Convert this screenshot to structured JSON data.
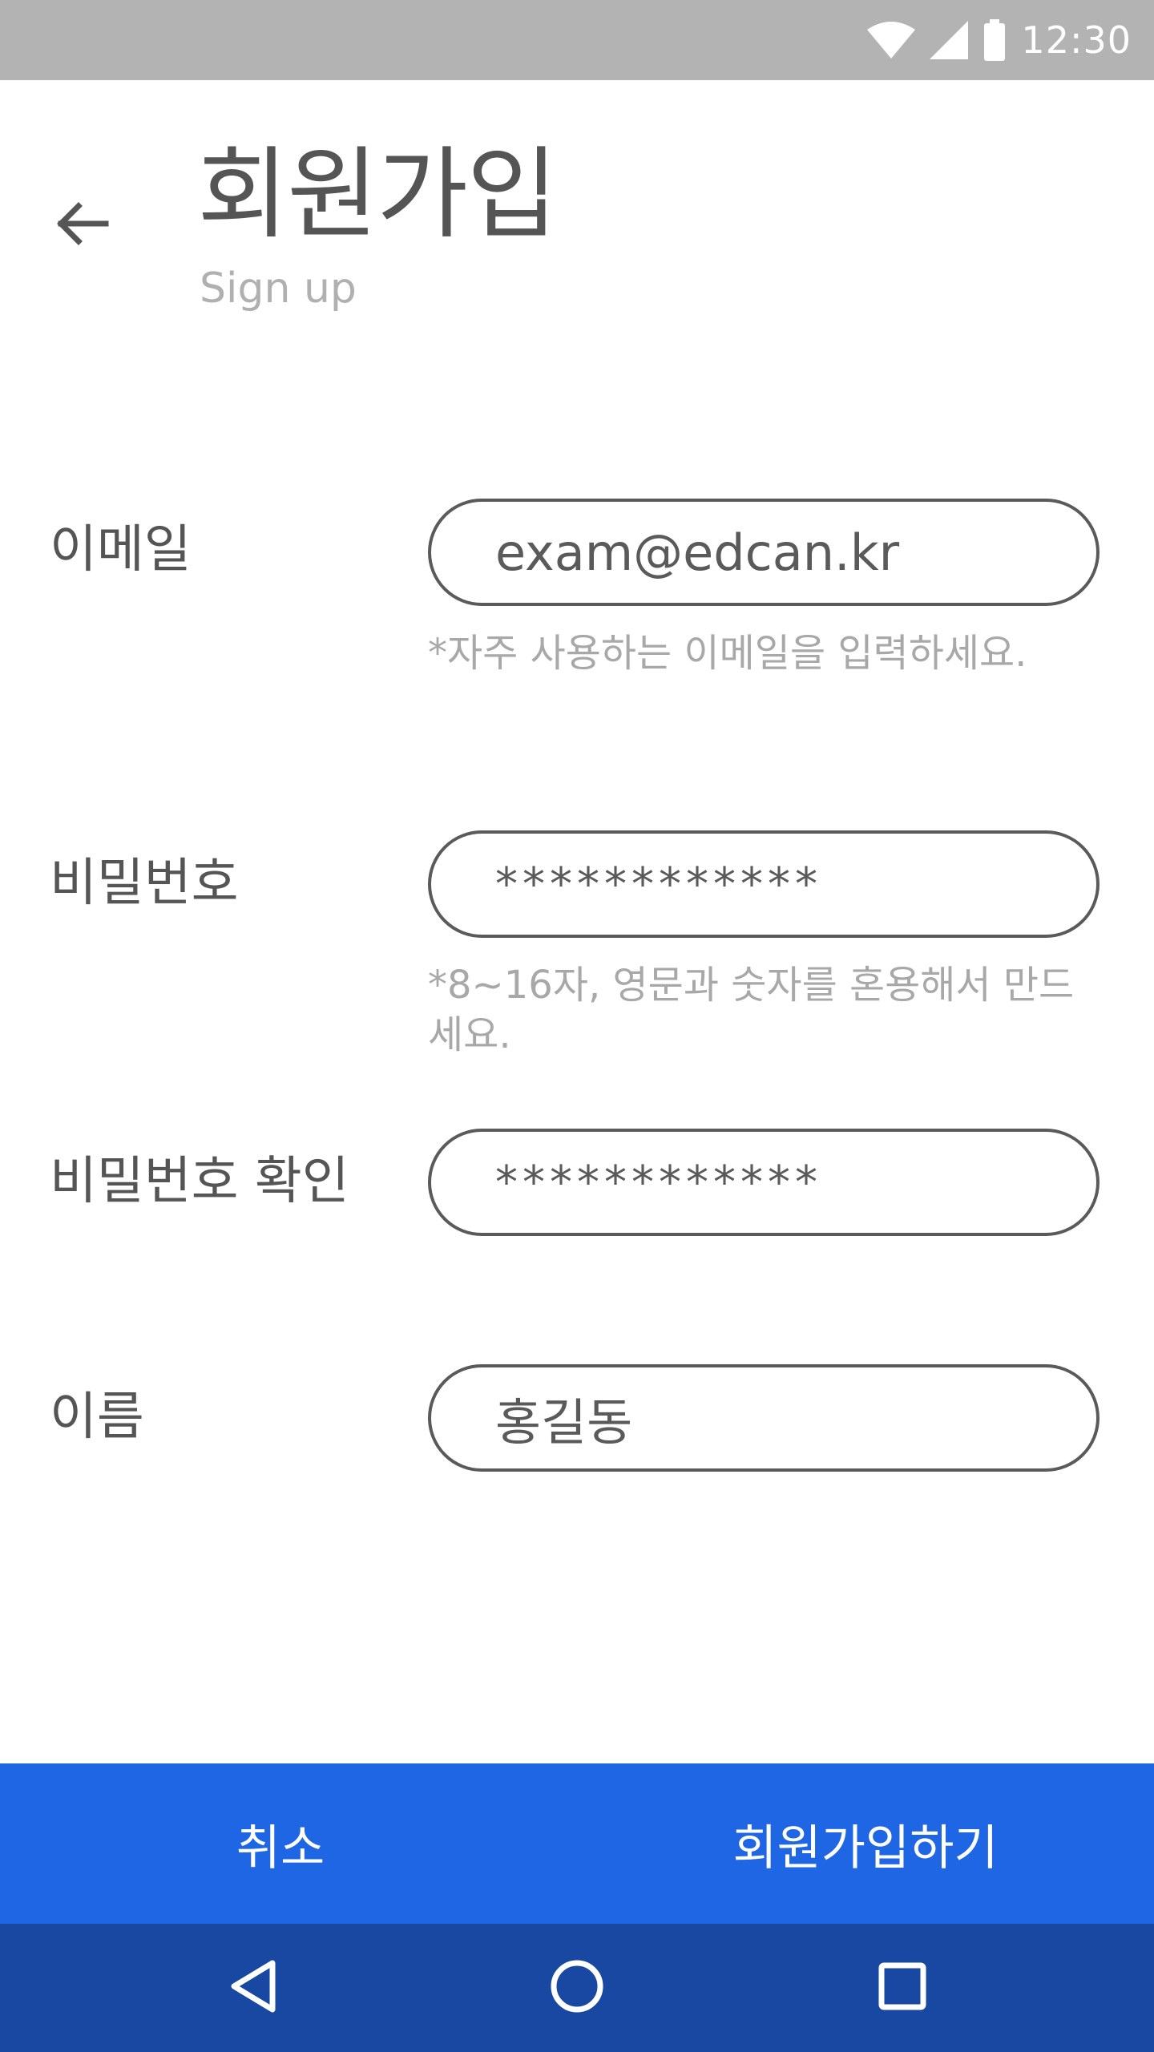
{
  "status_bar": {
    "time": "12:30",
    "icons": [
      "wifi-icon",
      "cell-signal-icon",
      "battery-icon"
    ]
  },
  "header": {
    "back_icon": "arrow-left-icon",
    "title": "회원가입",
    "subtitle": "Sign up"
  },
  "form": {
    "email": {
      "label": "이메일",
      "value": "exam@edcan.kr",
      "helper": "*자주 사용하는 이메일을 입력하세요."
    },
    "password": {
      "label": "비밀번호",
      "value": "************",
      "helper": "*8~16자, 영문과 숫자를 혼용해서 만드세요."
    },
    "password_confirm": {
      "label": "비밀번호 확인",
      "value": "************"
    },
    "name": {
      "label": "이름",
      "value": "홍길동"
    }
  },
  "actions": {
    "cancel_label": "취소",
    "submit_label": "회원가입하기"
  },
  "nav_bar": {
    "icons": [
      "nav-back-icon",
      "nav-home-icon",
      "nav-recents-icon"
    ]
  },
  "colors": {
    "status_bar": "#b3b3b3",
    "action_bar": "#1f66e5",
    "nav_bar": "#1848a2",
    "text": "#555555",
    "helper_text": "#a8a8a8"
  }
}
